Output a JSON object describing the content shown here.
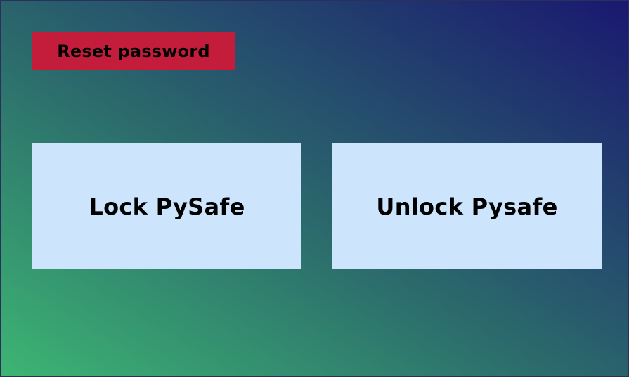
{
  "buttons": {
    "reset_label": "Reset password",
    "lock_label": "Lock PySafe",
    "unlock_label": "Unlock Pysafe"
  },
  "colors": {
    "gradient_bottom_left": "#3db573",
    "gradient_top_right": "#1a1870",
    "reset_button": "#c41d3c",
    "action_button": "#cce5fd"
  }
}
